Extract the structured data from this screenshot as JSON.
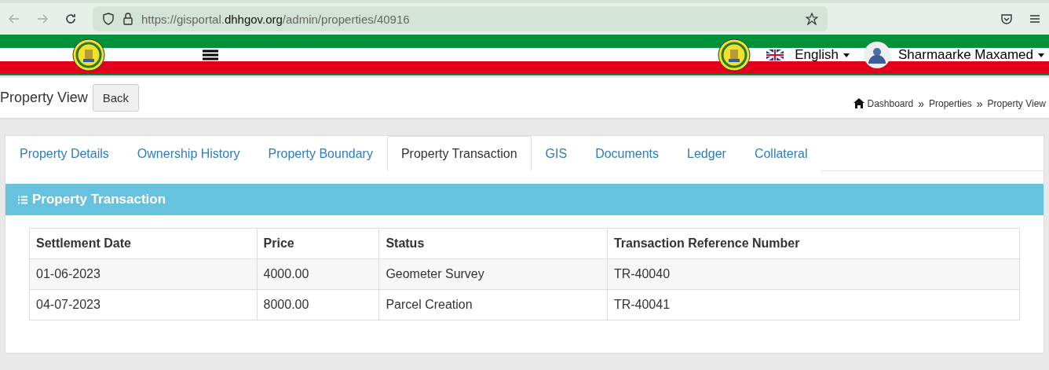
{
  "browser": {
    "url_prefix": "https://gisportal.",
    "url_host": "dhhgov.org",
    "url_path": "/admin/properties/40916"
  },
  "navbar": {
    "language": "English",
    "user": "Sharmaarke Maxamed"
  },
  "header": {
    "title": "Property View",
    "back": "Back",
    "breadcrumbs": [
      "Dashboard",
      "Properties",
      "Property View"
    ],
    "separator": "»"
  },
  "tabs": [
    {
      "label": "Property Details",
      "selected": false
    },
    {
      "label": "Ownership History",
      "selected": false
    },
    {
      "label": "Property Boundary",
      "selected": false
    },
    {
      "label": "Property Transaction",
      "selected": true
    },
    {
      "label": "GIS",
      "selected": false
    },
    {
      "label": "Documents",
      "selected": false
    },
    {
      "label": "Ledger",
      "selected": false
    },
    {
      "label": "Collateral",
      "selected": false
    }
  ],
  "panel": {
    "title": "Property Transaction"
  },
  "table": {
    "columns": [
      "Settlement Date",
      "Price",
      "Status",
      "Transaction Reference Number"
    ],
    "rows": [
      [
        "01-06-2023",
        "4000.00",
        "Geometer Survey",
        "TR-40040"
      ],
      [
        "04-07-2023",
        "8000.00",
        "Parcel Creation",
        "TR-40041"
      ]
    ]
  }
}
